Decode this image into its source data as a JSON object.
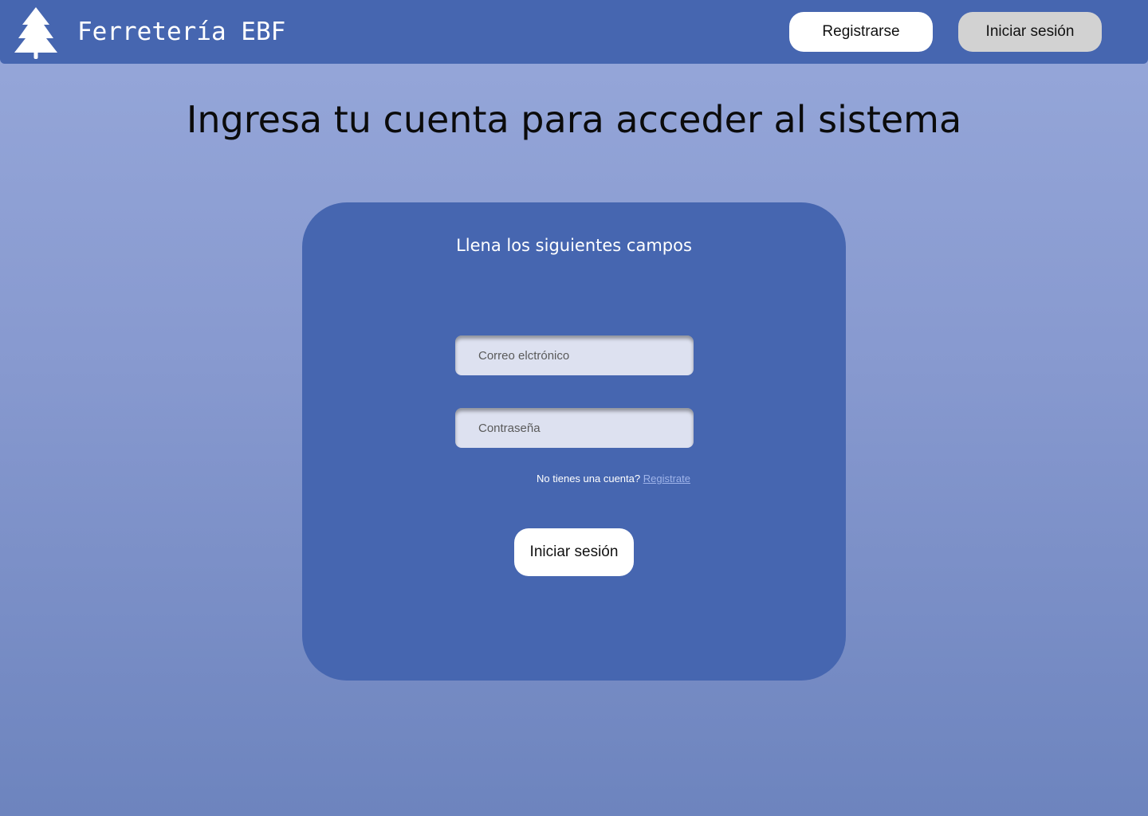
{
  "header": {
    "brand": "Ferretería EBF",
    "logo_icon": "tree-icon",
    "register_label": "Registrarse",
    "login_label": "Iniciar sesión"
  },
  "main": {
    "title": "Ingresa tu cuenta para acceder al sistema"
  },
  "form": {
    "heading": "Llena los siguientes campos",
    "email": {
      "placeholder": "Correo elctrónico",
      "value": ""
    },
    "password": {
      "placeholder": "Contraseña",
      "value": ""
    },
    "signup_prompt": "No tienes una cuenta?",
    "signup_link": "Registrate",
    "submit_label": "Iniciar sesión"
  },
  "colors": {
    "primary": "#4666b0",
    "background_top": "#97a8da",
    "background_bottom": "#6d84be",
    "field_background": "#dde1f0",
    "link": "#9fb4ea",
    "secondary_button": "#d2d2d2"
  }
}
